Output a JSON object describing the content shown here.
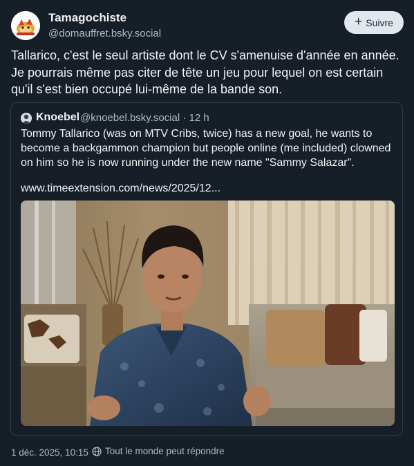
{
  "author": {
    "display_name": "Tamagochiste",
    "handle": "@domauffret.bsky.social"
  },
  "follow_button": {
    "icon": "plus-icon",
    "label": "Suivre"
  },
  "post": {
    "text": "Tallarico, c'est le seul artiste dont le CV s'amenuise d'année en année. Je pourrais même pas citer de tête un jeu pour lequel on est certain qu'il s'est bien occupé lui-même de la bande son."
  },
  "quote": {
    "author_name": "Knoebel",
    "author_handle": "@knoebel.bsky.social",
    "separator": "·",
    "time_ago": "12 h",
    "text": "Tommy Tallarico (was on MTV Cribs, twice) has a new goal, he wants to become a backgammon champion but people online (me included) clowned on him so he is now running under the new name \"Sammy Salazar\".",
    "link": "www.timeextension.com/news/2025/12..."
  },
  "footer": {
    "timestamp": "1 déc. 2025, 10:15",
    "reply_setting_icon": "globe-icon",
    "reply_setting": "Tout le monde peut répondre"
  },
  "colors": {
    "background": "#161e27",
    "text_primary": "#f1f3f5",
    "text_secondary": "#aebbc9",
    "border": "#2e3c4b",
    "follow_button_bg": "#e2e7ee"
  }
}
